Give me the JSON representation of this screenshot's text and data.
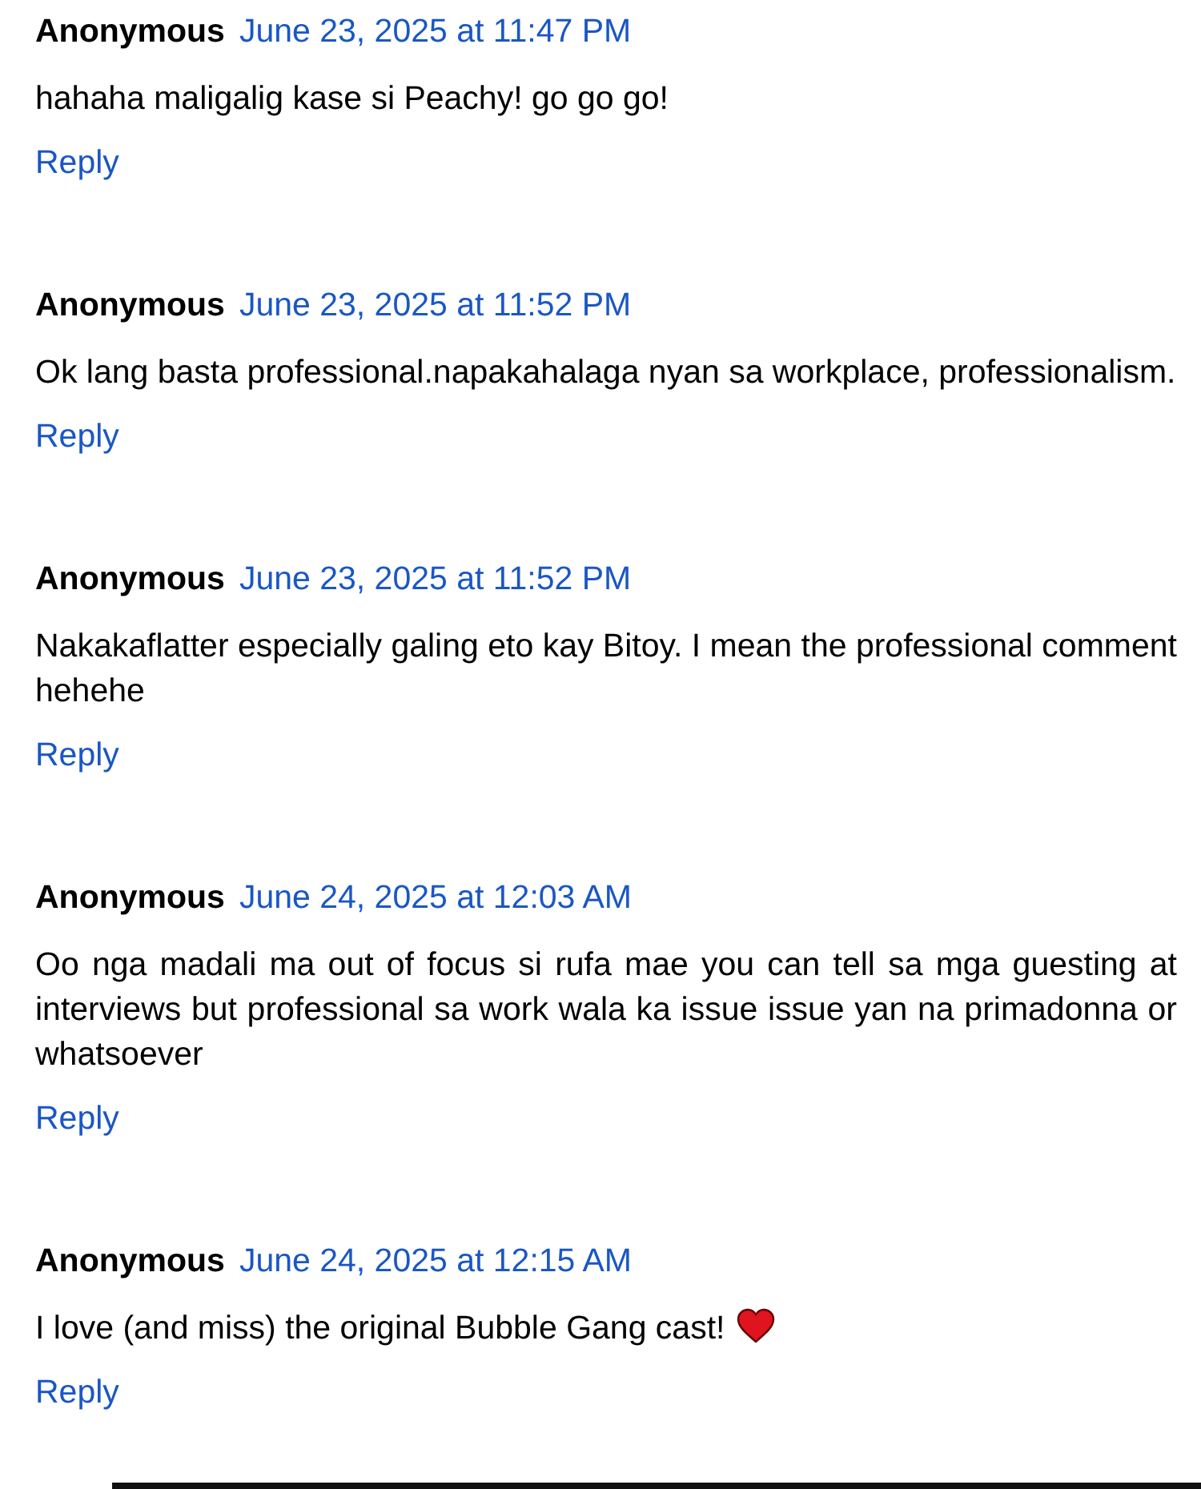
{
  "comments": [
    {
      "author": "Anonymous",
      "date": "June 23, 2025 at 11:47 PM",
      "text": "hahaha maligalig kase si Peachy! go go go!",
      "heart": false,
      "reply": "Reply"
    },
    {
      "author": "Anonymous",
      "date": "June 23, 2025 at 11:52 PM",
      "text": "Ok lang basta professional.napakahalaga nyan sa workplace, professionalism.",
      "heart": false,
      "reply": "Reply"
    },
    {
      "author": "Anonymous",
      "date": "June 23, 2025 at 11:52 PM",
      "text": "Nakakaflatter especially galing eto kay Bitoy. I mean the professional comment hehehe",
      "heart": false,
      "reply": "Reply"
    },
    {
      "author": "Anonymous",
      "date": "June 24, 2025 at 12:03 AM",
      "text": "Oo nga madali ma out of focus si rufa mae you can tell sa mga guesting at interviews but professional sa work wala ka issue issue yan na primadonna or whatsoever",
      "heart": false,
      "reply": "Reply"
    },
    {
      "author": "Anonymous",
      "date": "June 24, 2025 at 12:15 AM",
      "text": "I love (and miss) the original Bubble Gang cast!",
      "heart": true,
      "reply": "Reply"
    }
  ]
}
